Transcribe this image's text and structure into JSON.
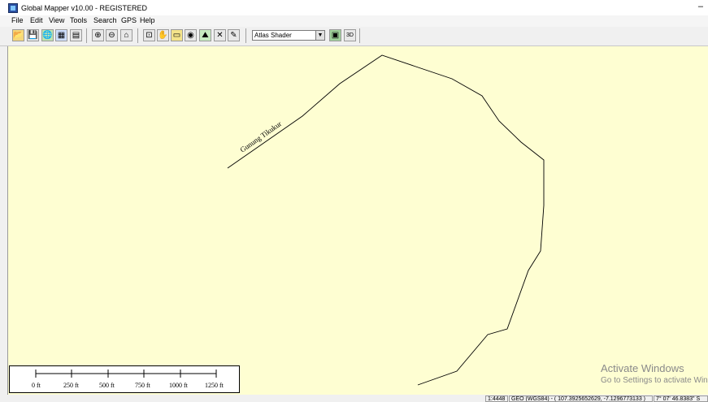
{
  "window": {
    "title": "Global Mapper v10.00 - REGISTERED",
    "minimize_glyph": "–"
  },
  "menu": [
    "File",
    "Edit",
    "View",
    "Tools",
    "Search",
    "GPS",
    "Help"
  ],
  "toolbar": {
    "shader_selected": "Atlas Shader",
    "icons": [
      "open-folder-icon",
      "save-icon",
      "globe-icon",
      "config-icon",
      "data-icon",
      "zoom-in-icon",
      "zoom-out-icon",
      "home-icon",
      "zoom-tool-icon",
      "pan-hand-icon",
      "measure-ruler-icon",
      "info-icon",
      "path-profile-icon",
      "digitizer-icon",
      "pen-edit-icon",
      "shader-image-icon",
      "view-3d-icon"
    ],
    "glyphs": [
      "📂",
      "💾",
      "🌐",
      "▦",
      "▤",
      "⊕",
      "⊖",
      "⌂",
      "⊡",
      "✋",
      "▭",
      "◉",
      "⛰",
      "✕",
      "✎",
      "▣",
      "3D"
    ]
  },
  "map": {
    "feature_label": "Gunung Tikukur",
    "line_color": "#000000",
    "background_color": "#fefed2"
  },
  "scalebar": {
    "labels": [
      "0 ft",
      "250 ft",
      "500 ft",
      "750 ft",
      "1000 ft",
      "1250 ft"
    ]
  },
  "watermark": {
    "title": "Activate Windows",
    "subtitle": "Go to Settings to activate Windows."
  },
  "status": {
    "scale": "1:4448",
    "coords": "GEO (WGS84) - ( 107.3925652629, -7.1296773133 )",
    "dms": "7° 07' 46.8383\" S"
  }
}
